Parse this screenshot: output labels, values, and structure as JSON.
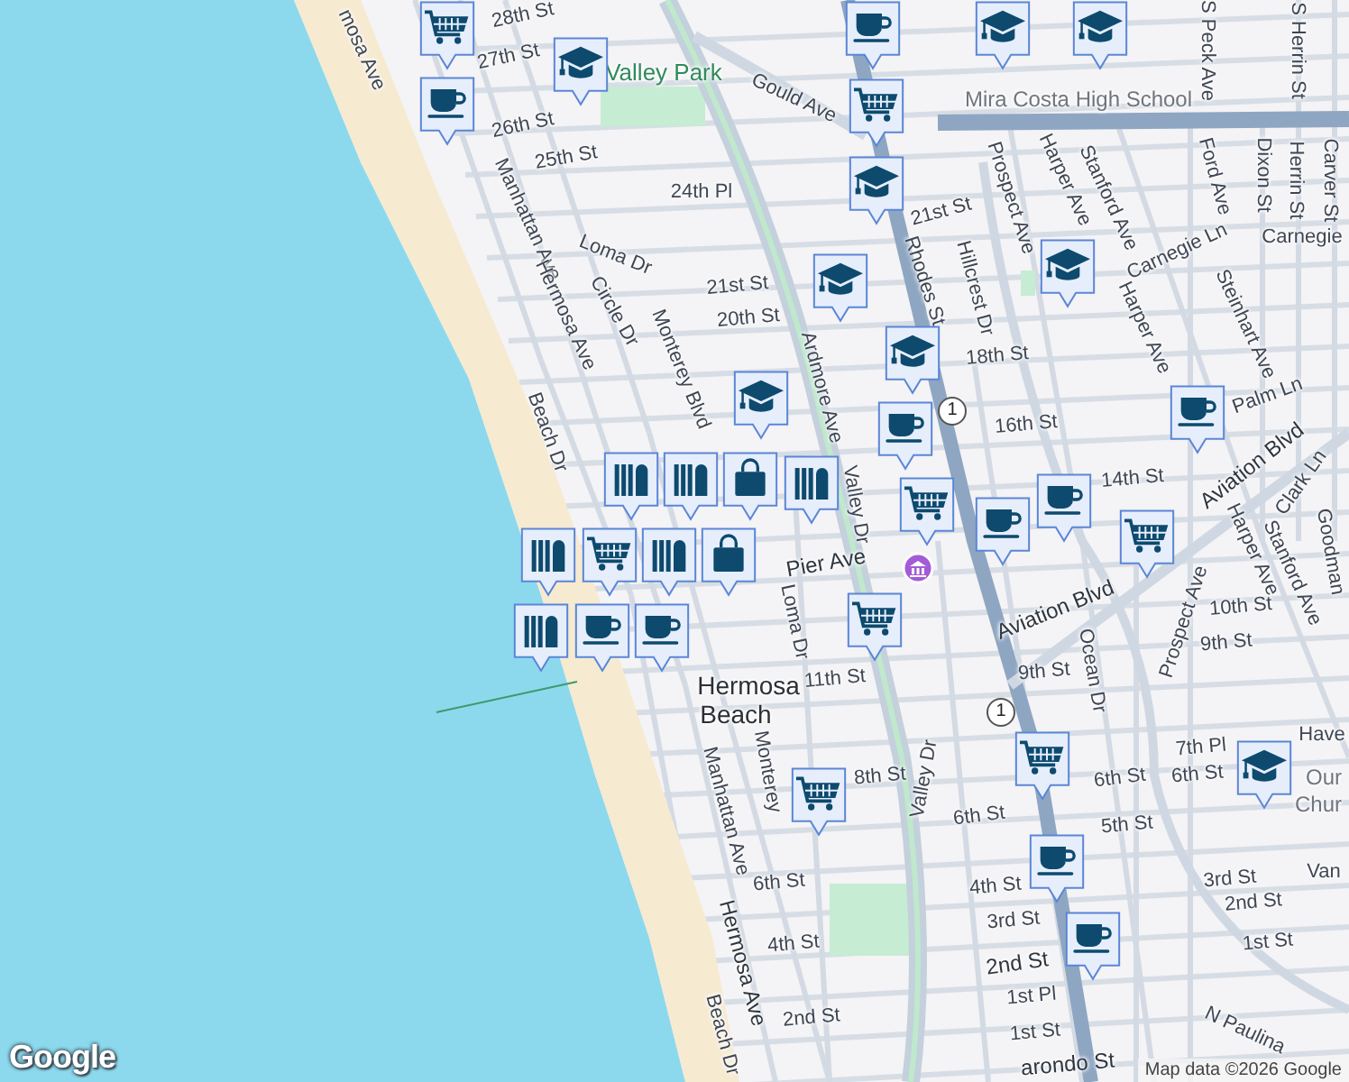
{
  "map": {
    "labels": [
      {
        "text": "mosa Ave",
        "kind": "street"
      },
      {
        "text": "28th St",
        "kind": "street"
      },
      {
        "text": "Valley Park",
        "kind": "park"
      },
      {
        "text": "27th St",
        "kind": "street"
      },
      {
        "text": "Gould Ave",
        "kind": "street"
      },
      {
        "text": "Mira Costa High School",
        "kind": "poi"
      },
      {
        "text": "26th St",
        "kind": "street"
      },
      {
        "text": "25th St",
        "kind": "street"
      },
      {
        "text": "24th Pl",
        "kind": "street"
      },
      {
        "text": "Harper Ave",
        "kind": "street"
      },
      {
        "text": "Ford Ave",
        "kind": "street"
      },
      {
        "text": "S Peck Ave",
        "kind": "street"
      },
      {
        "text": "Dixon St",
        "kind": "street"
      },
      {
        "text": "Herrin St",
        "kind": "street"
      },
      {
        "text": "S Herrin St",
        "kind": "street"
      },
      {
        "text": "Carver St",
        "kind": "street"
      },
      {
        "text": "Stanford Ave",
        "kind": "street"
      },
      {
        "text": "Prospect Ave",
        "kind": "street"
      },
      {
        "text": "21st St",
        "kind": "street"
      },
      {
        "text": "Manhattan Ave",
        "kind": "street"
      },
      {
        "text": "Carnegie",
        "kind": "street"
      },
      {
        "text": "Loma Dr",
        "kind": "street"
      },
      {
        "text": "Carnegie Ln",
        "kind": "street"
      },
      {
        "text": "Rhodes St",
        "kind": "street"
      },
      {
        "text": "Hillcrest Dr",
        "kind": "street"
      },
      {
        "text": "21st St",
        "kind": "street"
      },
      {
        "text": "Circle Dr",
        "kind": "street"
      },
      {
        "text": "20th St",
        "kind": "street"
      },
      {
        "text": "Hermosa Ave",
        "kind": "street"
      },
      {
        "text": "Harper Ave",
        "kind": "street"
      },
      {
        "text": "Steinhart Ave",
        "kind": "street"
      },
      {
        "text": "18th St",
        "kind": "street"
      },
      {
        "text": "Monterey Blvd",
        "kind": "street"
      },
      {
        "text": "Ardmore Ave",
        "kind": "street"
      },
      {
        "text": "Palm Ln",
        "kind": "street"
      },
      {
        "text": "16th St",
        "kind": "street"
      },
      {
        "text": "Beach Dr",
        "kind": "street"
      },
      {
        "text": "Aviation Blvd",
        "kind": "major"
      },
      {
        "text": "14th St",
        "kind": "street"
      },
      {
        "text": "Clark Ln",
        "kind": "street"
      },
      {
        "text": "Valley Dr",
        "kind": "street"
      },
      {
        "text": "Harper Ave",
        "kind": "street"
      },
      {
        "text": "Goodman",
        "kind": "street"
      },
      {
        "text": "Stanford Ave",
        "kind": "street"
      },
      {
        "text": "Pier Ave",
        "kind": "major"
      },
      {
        "text": "Aviation Blvd",
        "kind": "major"
      },
      {
        "text": "10th St",
        "kind": "street"
      },
      {
        "text": "Prospect Ave",
        "kind": "street"
      },
      {
        "text": "Loma Dr",
        "kind": "street"
      },
      {
        "text": "9th St",
        "kind": "street"
      },
      {
        "text": "Hermosa",
        "kind": "city"
      },
      {
        "text": "11th St",
        "kind": "street"
      },
      {
        "text": "Ocean Dr",
        "kind": "street"
      },
      {
        "text": "9th St",
        "kind": "street"
      },
      {
        "text": "Beach",
        "kind": "city"
      },
      {
        "text": "Have",
        "kind": "street"
      },
      {
        "text": "7th Pl",
        "kind": "street"
      },
      {
        "text": "Monterey",
        "kind": "street"
      },
      {
        "text": "Our",
        "kind": "poi"
      },
      {
        "text": "8th St",
        "kind": "street"
      },
      {
        "text": "Valley Dr",
        "kind": "street"
      },
      {
        "text": "6th St",
        "kind": "street"
      },
      {
        "text": "6th St",
        "kind": "street"
      },
      {
        "text": "Chur",
        "kind": "poi"
      },
      {
        "text": "Manhattan Ave",
        "kind": "street"
      },
      {
        "text": "6th St",
        "kind": "street"
      },
      {
        "text": "5th St",
        "kind": "street"
      },
      {
        "text": "Van",
        "kind": "street"
      },
      {
        "text": "3rd St",
        "kind": "street"
      },
      {
        "text": "6th St",
        "kind": "street"
      },
      {
        "text": "4th St",
        "kind": "street"
      },
      {
        "text": "2nd St",
        "kind": "street"
      },
      {
        "text": "3rd St",
        "kind": "street"
      },
      {
        "text": "1st St",
        "kind": "street"
      },
      {
        "text": "4th St",
        "kind": "street"
      },
      {
        "text": "2nd St",
        "kind": "major"
      },
      {
        "text": "Hermosa Ave",
        "kind": "major"
      },
      {
        "text": "1st Pl",
        "kind": "street"
      },
      {
        "text": "2nd St",
        "kind": "street"
      },
      {
        "text": "Beach Dr",
        "kind": "street"
      },
      {
        "text": "N Paulina",
        "kind": "street"
      },
      {
        "text": "1st St",
        "kind": "street"
      },
      {
        "text": "arondo St",
        "kind": "major"
      }
    ],
    "markers": [
      {
        "kind": "cart"
      },
      {
        "kind": "coffee"
      },
      {
        "kind": "school"
      },
      {
        "kind": "coffee"
      },
      {
        "kind": "school"
      },
      {
        "kind": "school"
      },
      {
        "kind": "cart"
      },
      {
        "kind": "school"
      },
      {
        "kind": "school"
      },
      {
        "kind": "school"
      },
      {
        "kind": "coffee"
      },
      {
        "kind": "cart"
      },
      {
        "kind": "school"
      },
      {
        "kind": "coffee"
      },
      {
        "kind": "books"
      },
      {
        "kind": "books"
      },
      {
        "kind": "bag"
      },
      {
        "kind": "cart"
      },
      {
        "kind": "books"
      },
      {
        "kind": "bag"
      },
      {
        "kind": "coffee"
      },
      {
        "kind": "coffee"
      },
      {
        "kind": "cart"
      },
      {
        "kind": "coffee"
      },
      {
        "kind": "coffee"
      },
      {
        "kind": "cart"
      },
      {
        "kind": "cart"
      },
      {
        "kind": "cart"
      },
      {
        "kind": "school"
      },
      {
        "kind": "coffee"
      },
      {
        "kind": "coffee"
      },
      {
        "kind": "books"
      },
      {
        "kind": "books"
      },
      {
        "kind": "books"
      },
      {
        "kind": "school"
      }
    ],
    "route_shields": [
      {
        "text": "1"
      },
      {
        "text": "1"
      }
    ],
    "logo": "Google",
    "attribution": "Map data ©2026 Google"
  }
}
